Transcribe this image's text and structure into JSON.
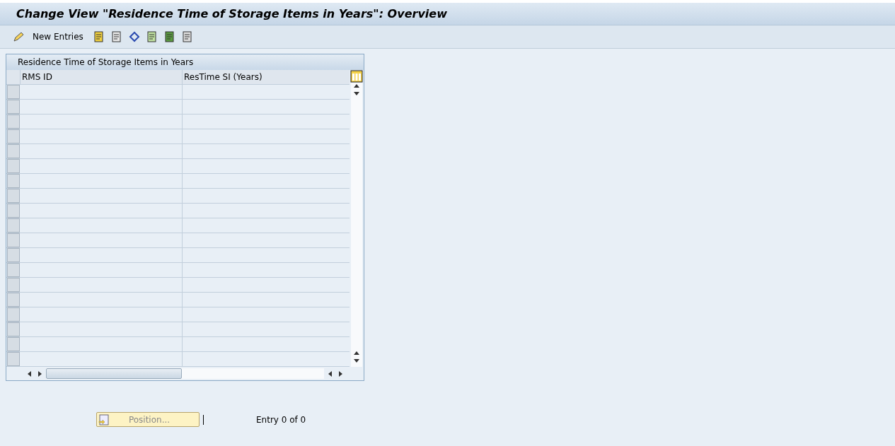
{
  "window": {
    "title": "Change View \"Residence Time of Storage Items in Years\": Overview"
  },
  "toolbar": {
    "new_entries": "New Entries"
  },
  "table": {
    "title": "Residence Time of Storage Items in Years",
    "columns": [
      "RMS ID",
      "ResTime SI (Years)"
    ]
  },
  "footer": {
    "position_button": {
      "label": "Position...",
      "disabled": true
    },
    "entry_text": "Entry 0 of 0"
  }
}
